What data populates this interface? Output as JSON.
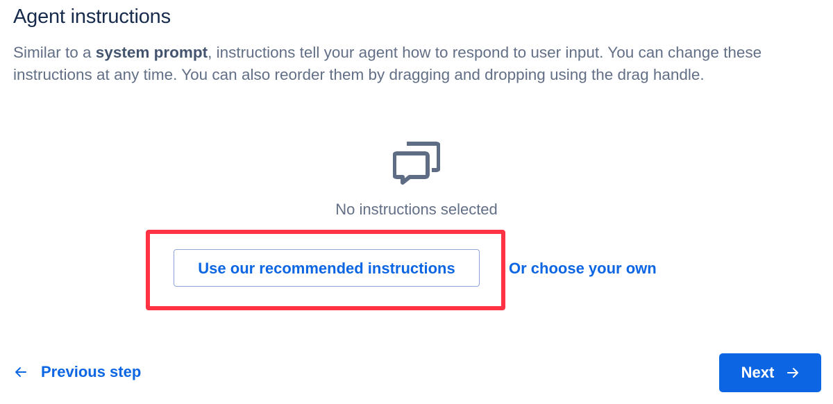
{
  "header": {
    "title": "Agent instructions",
    "description_pre": "Similar to a ",
    "description_bold": "system prompt",
    "description_post": ", instructions tell your agent how to respond to user input. You can change these instructions at any time. You can also reorder them by dragging and dropping using the drag handle."
  },
  "empty_state": {
    "icon": "chat-bubbles-icon",
    "message": "No instructions selected",
    "primary_button_label": "Use our recommended instructions",
    "secondary_link_label": "Or choose your own"
  },
  "footer": {
    "previous_label": "Previous step",
    "next_label": "Next"
  },
  "colors": {
    "accent": "#0c66e4",
    "highlight": "#ff3344",
    "text_primary": "#172b4d",
    "text_secondary": "#626f86"
  }
}
